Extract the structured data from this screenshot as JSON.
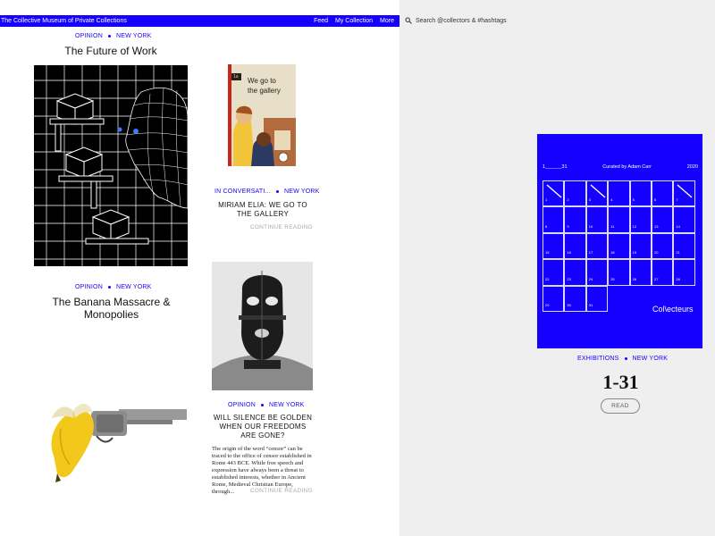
{
  "header": {
    "site_title": "The Collective Museum of Private Collections",
    "nav": [
      "Feed",
      "My Collection",
      "More"
    ]
  },
  "search": {
    "placeholder": "Search @collectors & #hashtags",
    "icon": "search-icon"
  },
  "articles": {
    "future_of_work": {
      "category": "OPINION",
      "location": "NEW YORK",
      "title": "The Future of Work"
    },
    "banana": {
      "category": "OPINION",
      "location": "NEW YORK",
      "title": "The Banana Massacre & Monopolies"
    },
    "miriam": {
      "category": "IN CONVERSATI...",
      "location": "NEW YORK",
      "title": "MIRIAM ELIA: WE GO TO THE GALLERY",
      "continue": "CONTINUE READING",
      "book_text_line1": "We go to",
      "book_text_line2": "the gallery",
      "book_tag": "1a"
    },
    "silence": {
      "category": "OPINION",
      "location": "NEW YORK",
      "title": "WILL SILENCE BE GOLDEN WHEN OUR FREEDOMS ARE GONE?",
      "excerpt": "The origin of the word “censor” can be traced to the office of censor established in Rome 443 BCE. While free speech and expression have always been a threat to established interests, whether in Ancient Rome, Medieval Christian Europe, through...",
      "continue": "CONTINUE READING"
    }
  },
  "exhibition": {
    "range": "1______31",
    "curated": "Curated by Adam Carr",
    "year": "2020",
    "brand": "Col\\ecteurs",
    "days": [
      "1",
      "2",
      "3",
      "4",
      "5",
      "6",
      "7",
      "8",
      "9",
      "10",
      "11",
      "12",
      "13",
      "14",
      "15",
      "16",
      "17",
      "18",
      "19",
      "20",
      "21",
      "22",
      "23",
      "24",
      "25",
      "26",
      "27",
      "28",
      "29",
      "30",
      "31"
    ],
    "category": "EXHIBITIONS",
    "location": "NEW YORK",
    "title": "1-31",
    "read_label": "READ",
    "accent": "#1500ff"
  }
}
